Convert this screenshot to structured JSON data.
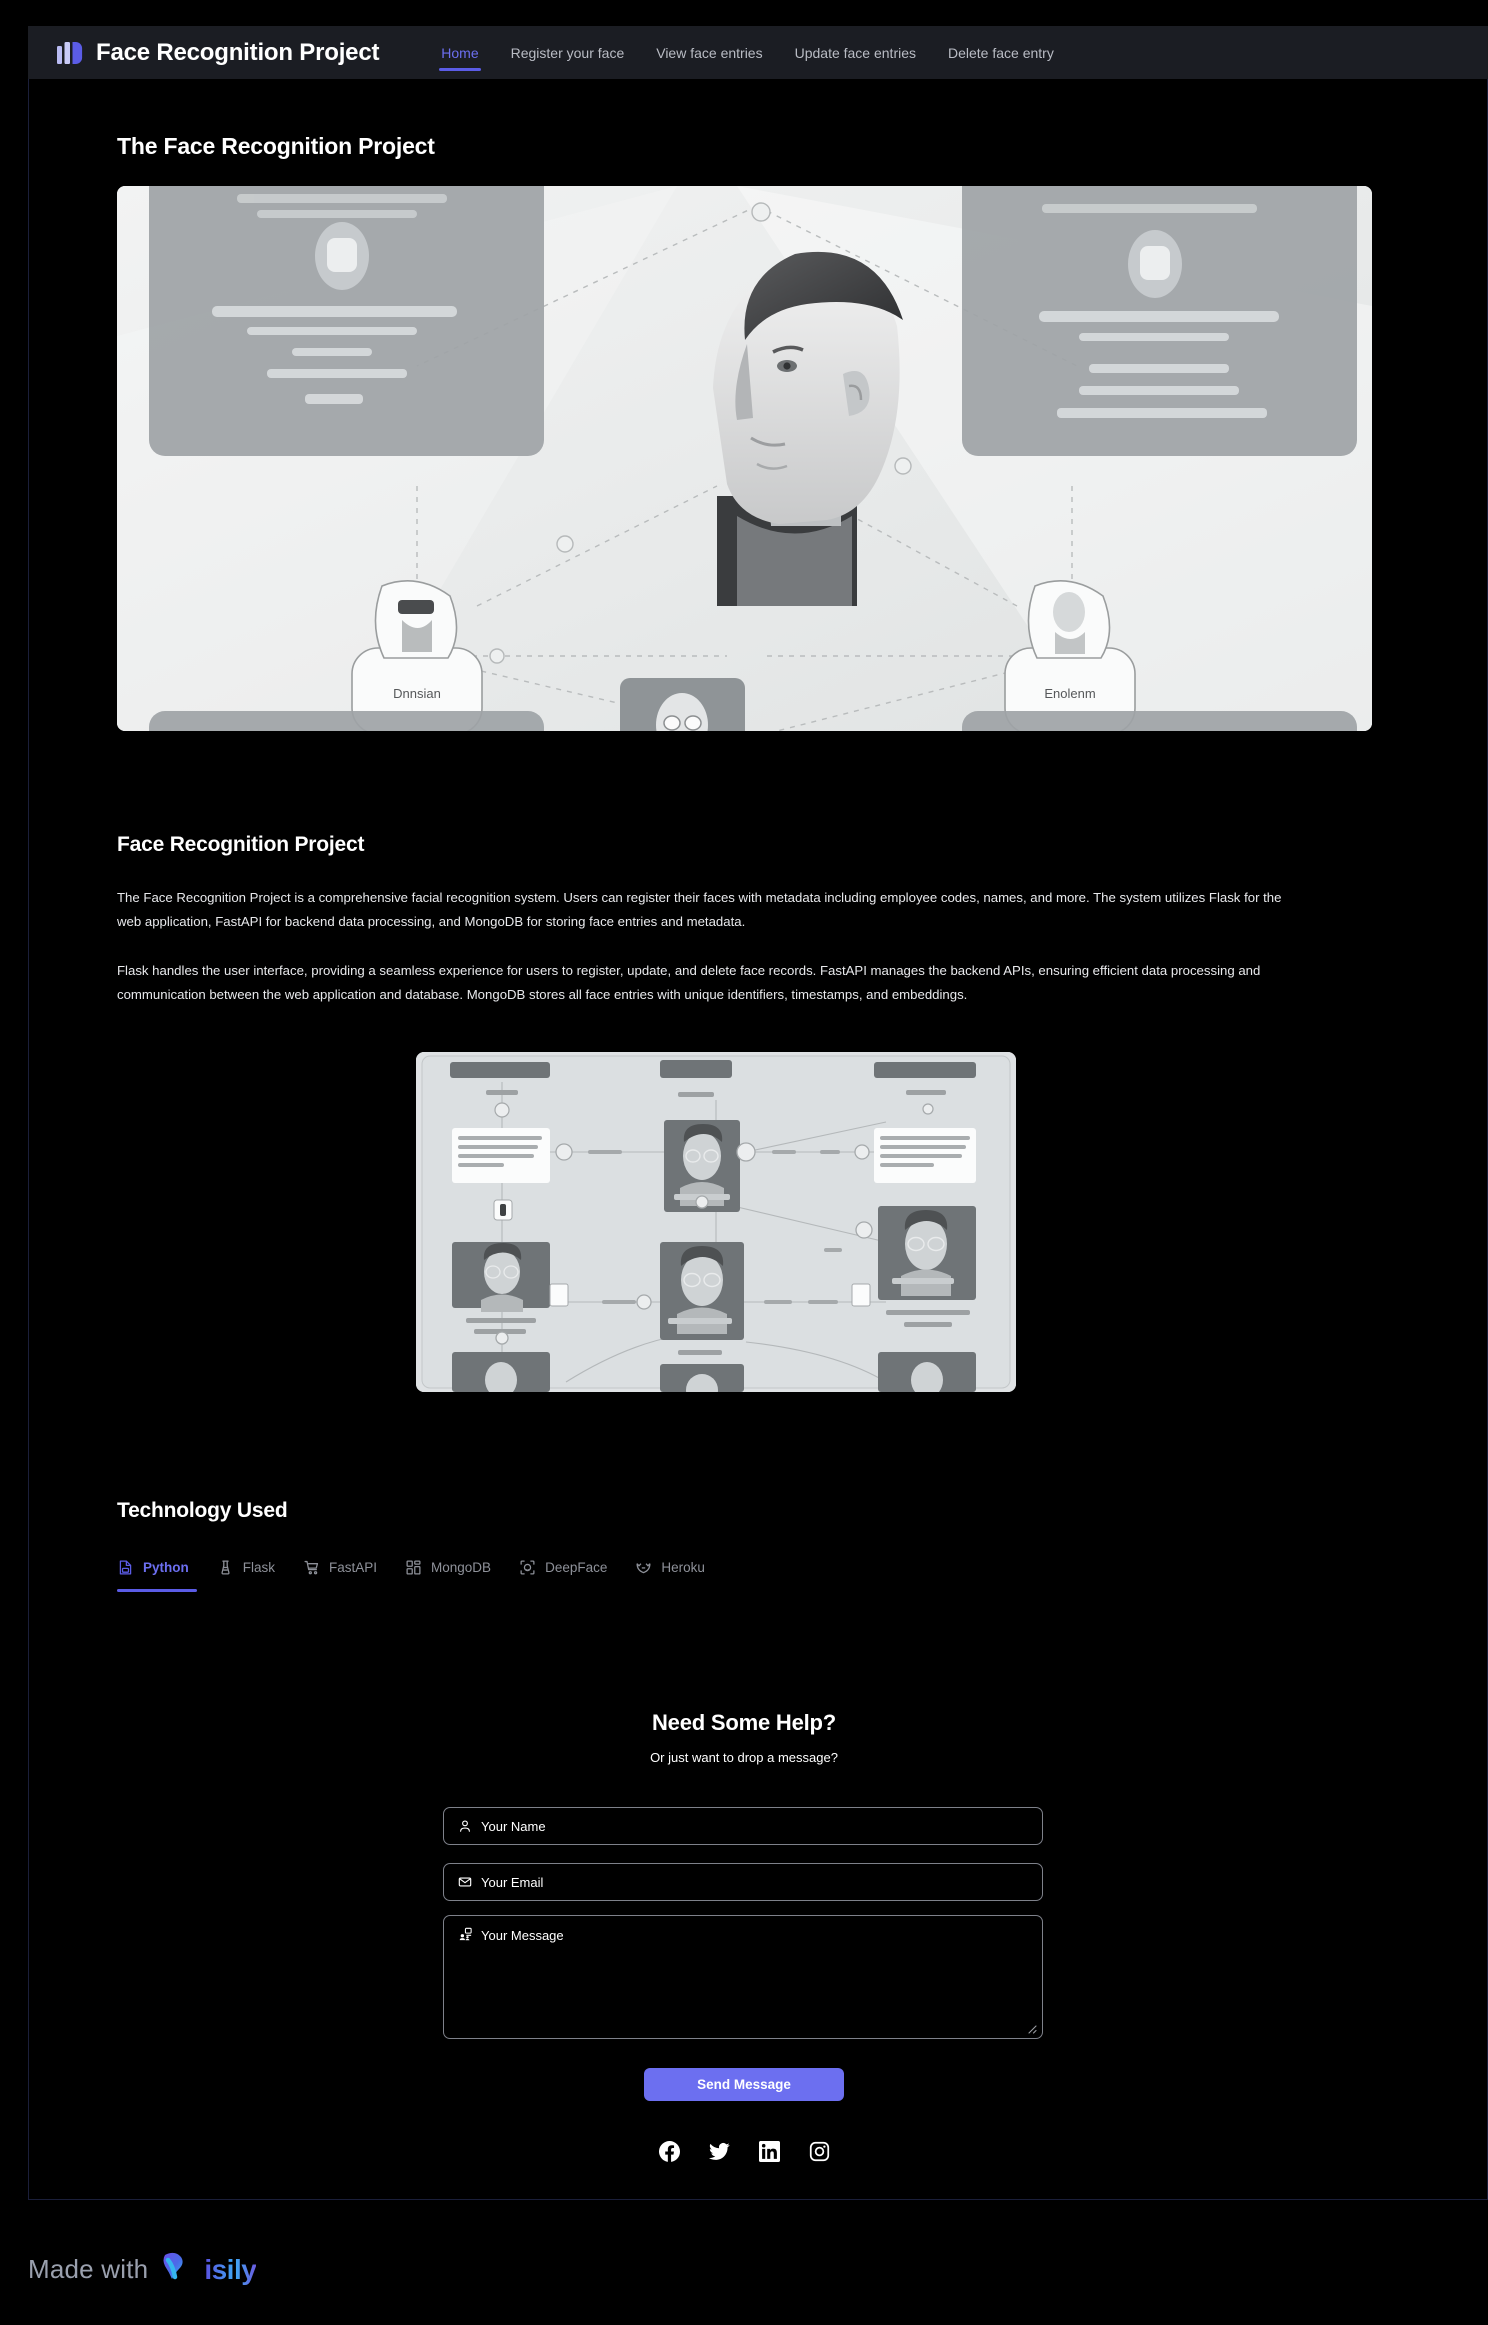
{
  "navbar": {
    "brand": "Face Recognition Project",
    "logo_icon": "bars-logo-icon",
    "links": [
      {
        "label": "Home",
        "active": true
      },
      {
        "label": "Register your face",
        "active": false
      },
      {
        "label": "View face entries",
        "active": false
      },
      {
        "label": "Update face entries",
        "active": false
      },
      {
        "label": "Delete face entry",
        "active": false
      }
    ]
  },
  "hero": {
    "title": "The Face Recognition Project",
    "image_alt": "face-recognition-network-diagram"
  },
  "about": {
    "title": "Face Recognition Project",
    "paragraph_1": "The Face Recognition Project is a comprehensive facial recognition system. Users can register their faces with metadata including employee codes, names, and more. The system utilizes Flask for the web application, FastAPI for backend data processing, and MongoDB for storing face entries and metadata.",
    "paragraph_2": "Flask handles the user interface, providing a seamless experience for users to register, update, and delete face records. FastAPI manages the backend APIs, ensuring efficient data processing and communication between the web application and database. MongoDB stores all face entries with unique identifiers, timestamps, and embeddings.",
    "image_alt": "face-entries-flow-diagram"
  },
  "technology": {
    "title": "Technology Used",
    "tabs": [
      {
        "label": "Python",
        "icon": "python-file-icon",
        "active": true
      },
      {
        "label": "Flask",
        "icon": "flask-icon",
        "active": false
      },
      {
        "label": "FastAPI",
        "icon": "fastapi-cart-icon",
        "active": false
      },
      {
        "label": "MongoDB",
        "icon": "mongodb-blocks-icon",
        "active": false
      },
      {
        "label": "DeepFace",
        "icon": "deepface-scan-icon",
        "active": false
      },
      {
        "label": "Heroku",
        "icon": "heroku-icon",
        "active": false
      }
    ]
  },
  "contact": {
    "title": "Need Some Help?",
    "subtitle": "Or just want to drop a message?",
    "name_placeholder": "Your Name",
    "email_placeholder": "Your Email",
    "message_placeholder": "Your Message",
    "send_label": "Send Message",
    "socials": [
      {
        "name": "facebook-icon"
      },
      {
        "name": "twitter-icon"
      },
      {
        "name": "linkedin-icon"
      },
      {
        "name": "instagram-icon"
      }
    ]
  },
  "footer": {
    "made_with": "Made with",
    "brand": "isily"
  },
  "colors": {
    "accent": "#6c6ff0",
    "accent_underline": "#5b5ce6",
    "navbar_bg": "#1b1d23",
    "page_bg": "#000000",
    "muted_text": "#8e9199",
    "border": "#7e818a"
  }
}
